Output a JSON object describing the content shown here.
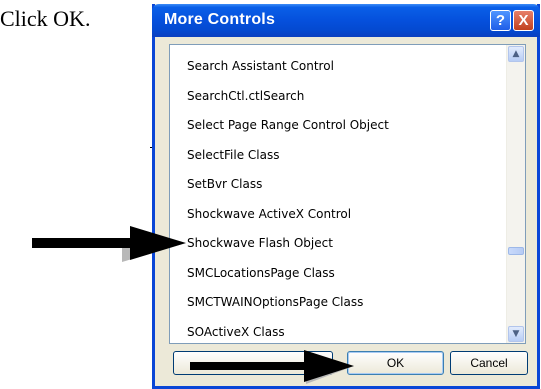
{
  "doc": {
    "text": "Click OK."
  },
  "dialog": {
    "title": "More Controls",
    "help_glyph": "?",
    "close_glyph": "X",
    "items": [
      "Search Assistant Control",
      "SearchCtl.ctlSearch",
      "Select Page Range Control Object",
      "SelectFile Class",
      "SetBvr Class",
      "Shockwave ActiveX Control",
      "Shockwave Flash Object",
      "SMCLocationsPage Class",
      "SMCTWAINOptionsPage Class",
      "SOActiveX Class"
    ],
    "ok_label": "OK",
    "cancel_label": "Cancel",
    "scroll_up_glyph": "▲",
    "scroll_down_glyph": "▼"
  },
  "colors": {
    "titlebar": "#0550dc",
    "dialog_bg": "#ece9d8",
    "list_border": "#7f9db9"
  }
}
